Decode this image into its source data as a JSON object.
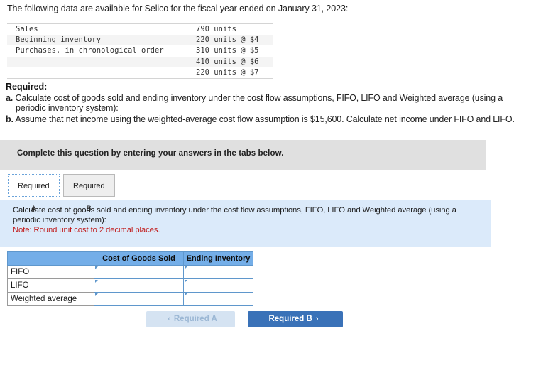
{
  "intro": "The following data are available for Selico for the fiscal year ended on January 31, 2023:",
  "facts": {
    "rows": [
      {
        "label": "Sales",
        "value": "790 units"
      },
      {
        "label": "Beginning inventory",
        "value": "220 units @ $4"
      },
      {
        "label": "Purchases, in chronological order",
        "value": "310 units @ $5"
      },
      {
        "label": "",
        "value": "410 units @ $6"
      },
      {
        "label": "",
        "value": "220 units @ $7"
      }
    ]
  },
  "required": {
    "heading": "Required:",
    "a_marker": "a.",
    "a_line1": "Calculate cost of goods sold and ending inventory under the cost flow assumptions, FIFO, LIFO and Weighted average (using a",
    "a_line2": "periodic inventory system):",
    "b_marker": "b.",
    "b_text": "Assume that net income using the weighted-average cost flow assumption is $15,600. Calculate net income under FIFO and LIFO."
  },
  "banner": {
    "text": "Complete this question by entering your answers in the tabs below."
  },
  "tabs": [
    {
      "label": "Required A",
      "active": true
    },
    {
      "label": "Required B",
      "active": false
    }
  ],
  "panel": {
    "line1": "Calculate cost of goods sold and ending inventory under the cost flow assumptions, FIFO, LIFO and Weighted average (using a",
    "line2": "periodic inventory system):",
    "note": "Note: Round unit cost to 2 decimal places.",
    "note_color": "#c11a1a",
    "background": "#dbeafa"
  },
  "grid": {
    "corner_header": "",
    "headers": [
      "Cost of Goods Sold",
      "Ending Inventory"
    ],
    "header_color": "#74aee8",
    "rows": [
      {
        "label": "FIFO",
        "cogs": "",
        "ending": ""
      },
      {
        "label": "LIFO",
        "cogs": "",
        "ending": ""
      },
      {
        "label": "Weighted average",
        "cogs": "",
        "ending": ""
      }
    ]
  },
  "nav": {
    "prev_label": "Required A",
    "prev_icon": "chevron-left",
    "prev_glyph": "‹",
    "next_label": "Required B",
    "next_icon": "chevron-right",
    "next_glyph": "›",
    "next_color": "#3a72b8",
    "prev_color": "#d5e3f2"
  }
}
